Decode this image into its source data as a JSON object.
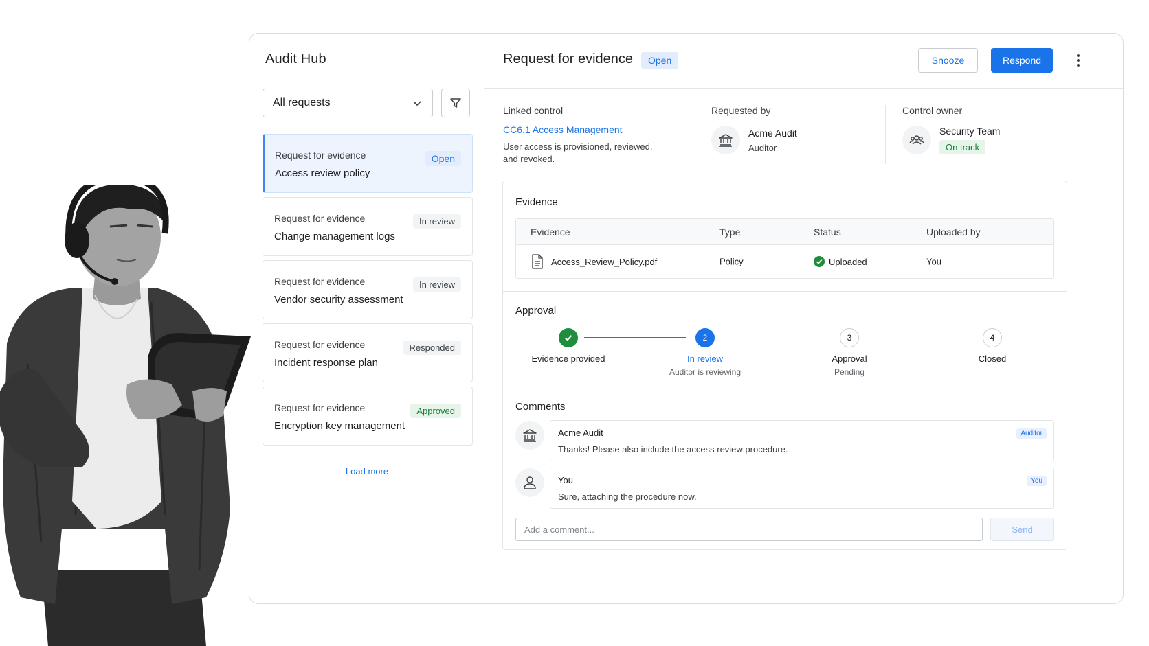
{
  "sidebar": {
    "title": "Audit Hub",
    "filter_value": "All requests",
    "requests": [
      {
        "kind": "Request for evidence",
        "name": "Access review policy",
        "status": "Open"
      },
      {
        "kind": "Request for evidence",
        "name": "Change management logs",
        "status": "In review"
      },
      {
        "kind": "Request for evidence",
        "name": "Vendor security assessment",
        "status": "In review"
      },
      {
        "kind": "Request for evidence",
        "name": "Incident response plan",
        "status": "Responded"
      },
      {
        "kind": "Request for evidence",
        "name": "Encryption key management",
        "status": "Approved"
      }
    ],
    "load_more": "Load more"
  },
  "header": {
    "title": "Request for evidence",
    "status": "Open",
    "snooze_label": "Snooze",
    "respond_label": "Respond"
  },
  "meta": {
    "linked_control_label": "Linked control",
    "linked_control_link": "CC6.1 Access Management",
    "linked_control_desc": "User access is provisioned, reviewed, and revoked.",
    "requested_by_label": "Requested by",
    "requester_name": "Acme Audit",
    "requester_role": "Auditor",
    "owner_label": "Control owner",
    "owner_name": "Security Team",
    "owner_status": "On track"
  },
  "evidence": {
    "title": "Evidence",
    "columns": [
      "Evidence",
      "Type",
      "Status",
      "Uploaded by"
    ],
    "rows": [
      {
        "file": "Access_Review_Policy.pdf",
        "type": "Policy",
        "status": "Uploaded",
        "uploaded_by": "You"
      }
    ]
  },
  "approval": {
    "title": "Approval",
    "steps": [
      {
        "number": "",
        "label": "Evidence provided",
        "sub": "",
        "state": "done"
      },
      {
        "number": "2",
        "label": "In review",
        "sub": "Auditor is reviewing",
        "state": "current"
      },
      {
        "number": "3",
        "label": "Approval",
        "sub": "Pending",
        "state": "todo"
      },
      {
        "number": "4",
        "label": "Closed",
        "sub": "",
        "state": "todo"
      }
    ]
  },
  "comments": {
    "title": "Comments",
    "items": [
      {
        "author": "Acme Audit",
        "text": "Thanks! Please also include the access review procedure.",
        "tag": "Auditor",
        "avatar_icon": "bank-icon"
      },
      {
        "author": "You",
        "text": "Sure, attaching the procedure now.",
        "tag": "You",
        "avatar_icon": "person-icon"
      }
    ],
    "input_placeholder": "Add a comment...",
    "send_label": "Send"
  },
  "colors": {
    "accent": "#1a73e8",
    "success": "#1e8e3e",
    "open_badge_bg": "#e2ecfc",
    "approved_badge_bg": "#e6f4ea"
  }
}
